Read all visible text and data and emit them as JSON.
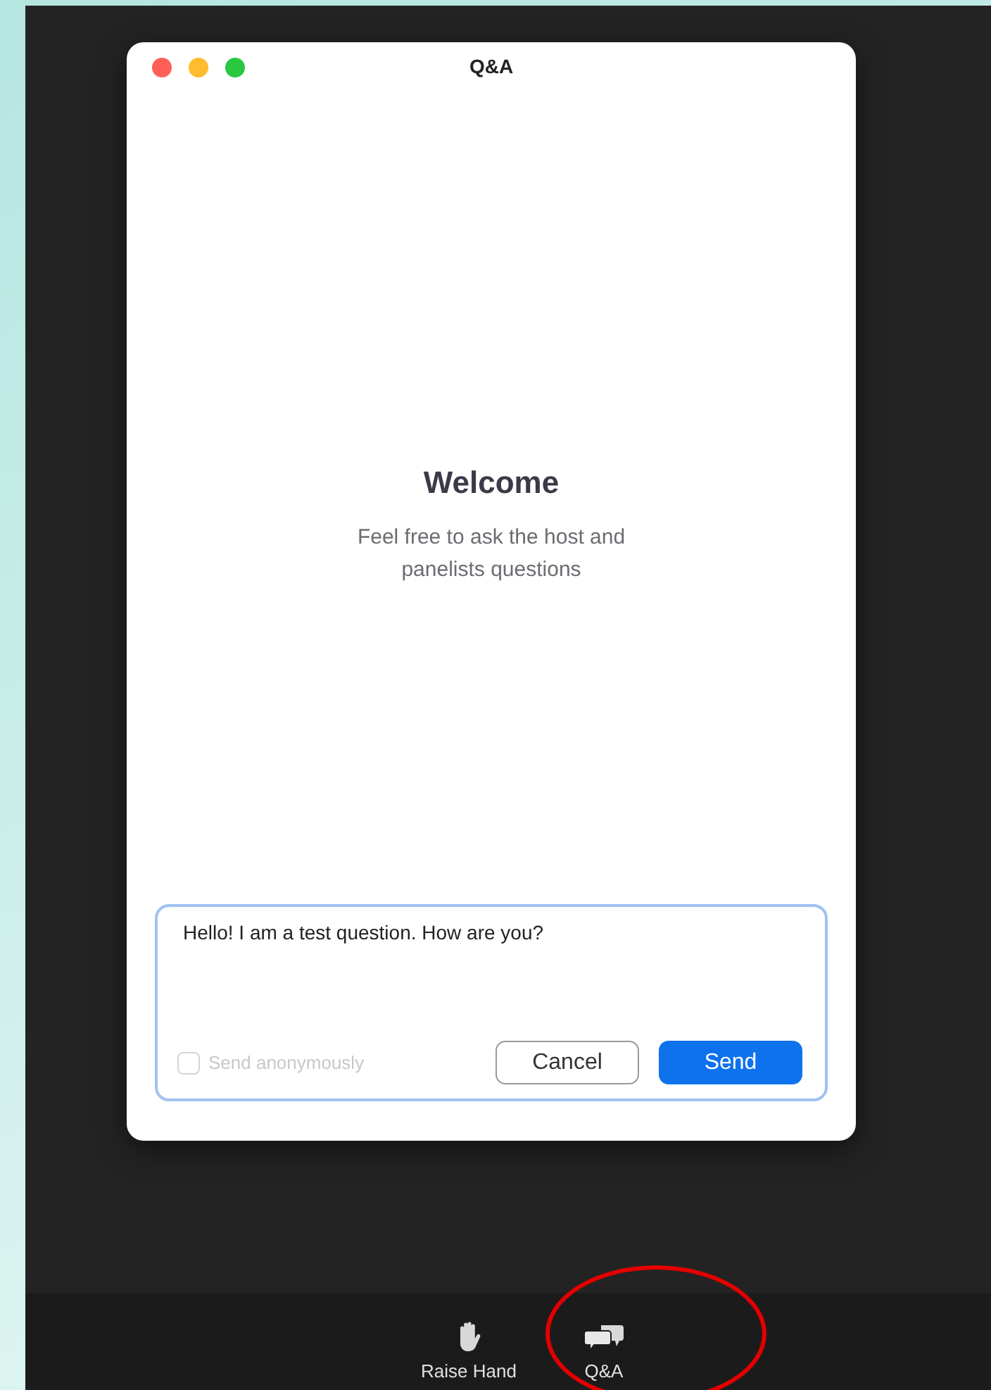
{
  "window": {
    "title": "Q&A"
  },
  "welcome": {
    "heading": "Welcome",
    "message": "Feel free to ask the host and panelists questions"
  },
  "question": {
    "value": "Hello! I am a test question. How are you?"
  },
  "anonymous": {
    "label": "Send anonymously",
    "checked": false,
    "disabled": true
  },
  "buttons": [
    {
      "label": "Cancel",
      "kind": "secondary"
    },
    {
      "label": "Send",
      "kind": "primary"
    }
  ],
  "toolbar": [
    {
      "label": "Raise Hand",
      "kind": "hand"
    },
    {
      "label": "Q&A",
      "kind": "chat"
    }
  ]
}
